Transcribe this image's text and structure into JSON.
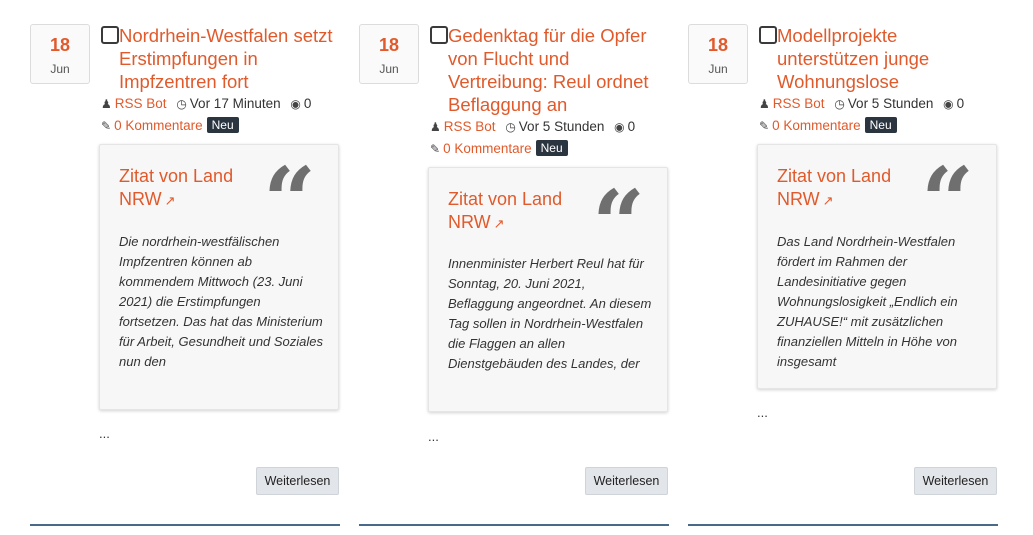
{
  "posts": [
    {
      "day": "18",
      "month": "Jun",
      "title": "Nordrhein-Westfalen setzt Erstimpfungen in Impfzentren fort",
      "author": "RSS Bot",
      "time": "Vor 17 Minuten",
      "views": "0",
      "comments": "0 Kommentare",
      "badge": "Neu",
      "quote_title": "Zitat von Land NRW",
      "quote_text": "Die nordrhein-westfälischen Impfzentren können ab kommendem Mittwoch (23. Juni 2021) die Erstimpfungen fortsetzen. Das hat das Ministerium für Arbeit, Gesundheit und Soziales nun den",
      "ellipsis": "...",
      "read_more": "Weiterlesen"
    },
    {
      "day": "18",
      "month": "Jun",
      "title": "Gedenktag für die Opfer von Flucht und Vertreibung: Reul ordnet Beflaggung an",
      "author": "RSS Bot",
      "time": "Vor 5 Stunden",
      "views": "0",
      "comments": "0 Kommentare",
      "badge": "Neu",
      "quote_title": "Zitat von Land NRW",
      "quote_text": "Innenminister Herbert Reul hat für Sonntag, 20. Juni 2021, Beflaggung angeordnet. An diesem Tag sollen in Nordrhein-Westfalen die Flaggen an allen Dienstgebäuden des Landes, der",
      "ellipsis": "...",
      "read_more": "Weiterlesen"
    },
    {
      "day": "18",
      "month": "Jun",
      "title": "Modellprojekte unterstützen junge Wohnungslose",
      "author": "RSS Bot",
      "time": "Vor 5 Stunden",
      "views": "0",
      "comments": "0 Kommentare",
      "badge": "Neu",
      "quote_title": "Zitat von Land NRW",
      "quote_text": "Das Land Nordrhein-Westfalen fördert im Rahmen der Landesinitiative gegen Wohnungslosigkeit „Endlich ein ZUHAUSE!“ mit zusätzlichen finanziellen Mitteln in Höhe von insgesamt",
      "ellipsis": "...",
      "read_more": "Weiterlesen"
    }
  ],
  "colors": {
    "accent": "#e05a2b",
    "badge": "#2a3540",
    "rule": "#4a6a8a"
  },
  "icons": {
    "author": "user-icon",
    "time": "clock-icon",
    "views": "eye-icon",
    "comments": "comments-icon",
    "external": "external-link-icon",
    "quote": "quote-icon"
  }
}
